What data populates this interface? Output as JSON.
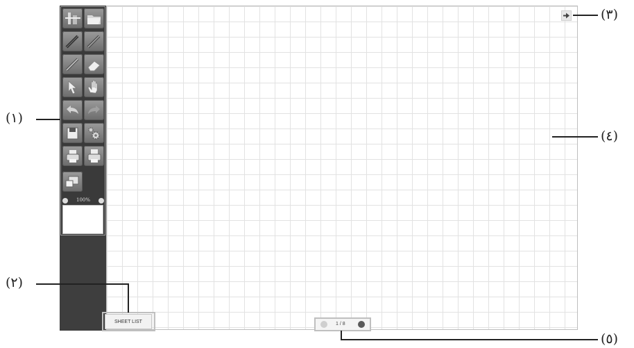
{
  "callouts": {
    "c1": "(١)",
    "c2": "(٢)",
    "c3": "(٣)",
    "c4": "(٤)",
    "c5": "(٥)"
  },
  "toolbar": {
    "tools": [
      {
        "name": "pen-width-icon"
      },
      {
        "name": "open-folder-icon"
      },
      {
        "name": "pen-black-icon"
      },
      {
        "name": "pen-red-icon"
      },
      {
        "name": "pen-blue-icon"
      },
      {
        "name": "eraser-icon"
      },
      {
        "name": "pointer-icon"
      },
      {
        "name": "hand-icon"
      },
      {
        "name": "undo-icon"
      },
      {
        "name": "redo-icon"
      },
      {
        "name": "save-icon"
      },
      {
        "name": "settings-icon"
      },
      {
        "name": "print-icon"
      },
      {
        "name": "print-all-icon"
      },
      {
        "name": "display-icon"
      }
    ],
    "zoom_label": "100%"
  },
  "sheet_list_label": "SHEET LIST",
  "pager": {
    "page_label": "1 / 8"
  },
  "colors": {
    "sidebar": "#3e3e3e",
    "canvas_border": "#bdbdbd",
    "grid": "#e2e2e2",
    "callout": "#222222"
  }
}
